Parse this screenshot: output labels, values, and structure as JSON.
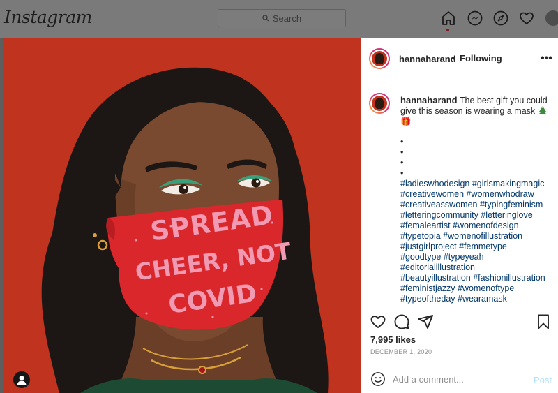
{
  "nav": {
    "logo": "Instagram",
    "search_placeholder": "Search",
    "icons": [
      "home-icon",
      "messenger-icon",
      "explore-icon",
      "heart-icon",
      "profile-avatar"
    ]
  },
  "post": {
    "image_text": [
      "SPREAD",
      "CHEER, NOT",
      "COVID"
    ],
    "header": {
      "username": "hannaharand",
      "separator": "•",
      "follow_status": "Following",
      "more": "•••"
    },
    "caption": {
      "username": "hannaharand",
      "text": "The best gift you could give this season is wearing a mask",
      "emojis": "🎁",
      "dots": [
        "•",
        "•",
        "•",
        "•"
      ],
      "hashtag_lines": [
        "#ladieswhodesign #girlsmakingmagic",
        "#creativewomen #womenwhodraw",
        "#creativeasswomen #typingfeminism",
        "#letteringcommunity #letteringlove",
        "#femaleartist #womenofdesign",
        "#typetopia #womenofillustration",
        "#justgirlproject #femmetype",
        "#goodtype #typeyeah",
        "#editorialillustration",
        "#beautyillustration #fashionillustration",
        "#feministjazzy #womenoftype",
        "#typeoftheday #wearamask"
      ]
    },
    "likes": "7,995 likes",
    "date": "DECEMBER 1, 2020",
    "comment": {
      "placeholder": "Add a comment...",
      "post_label": "Post"
    }
  },
  "colors": {
    "background_red": "#c0331f",
    "mask_red": "#d9272b",
    "mask_letter_pink": "#f19ab3",
    "hashtag_blue": "#00376b",
    "post_button": "#b2dffc"
  }
}
